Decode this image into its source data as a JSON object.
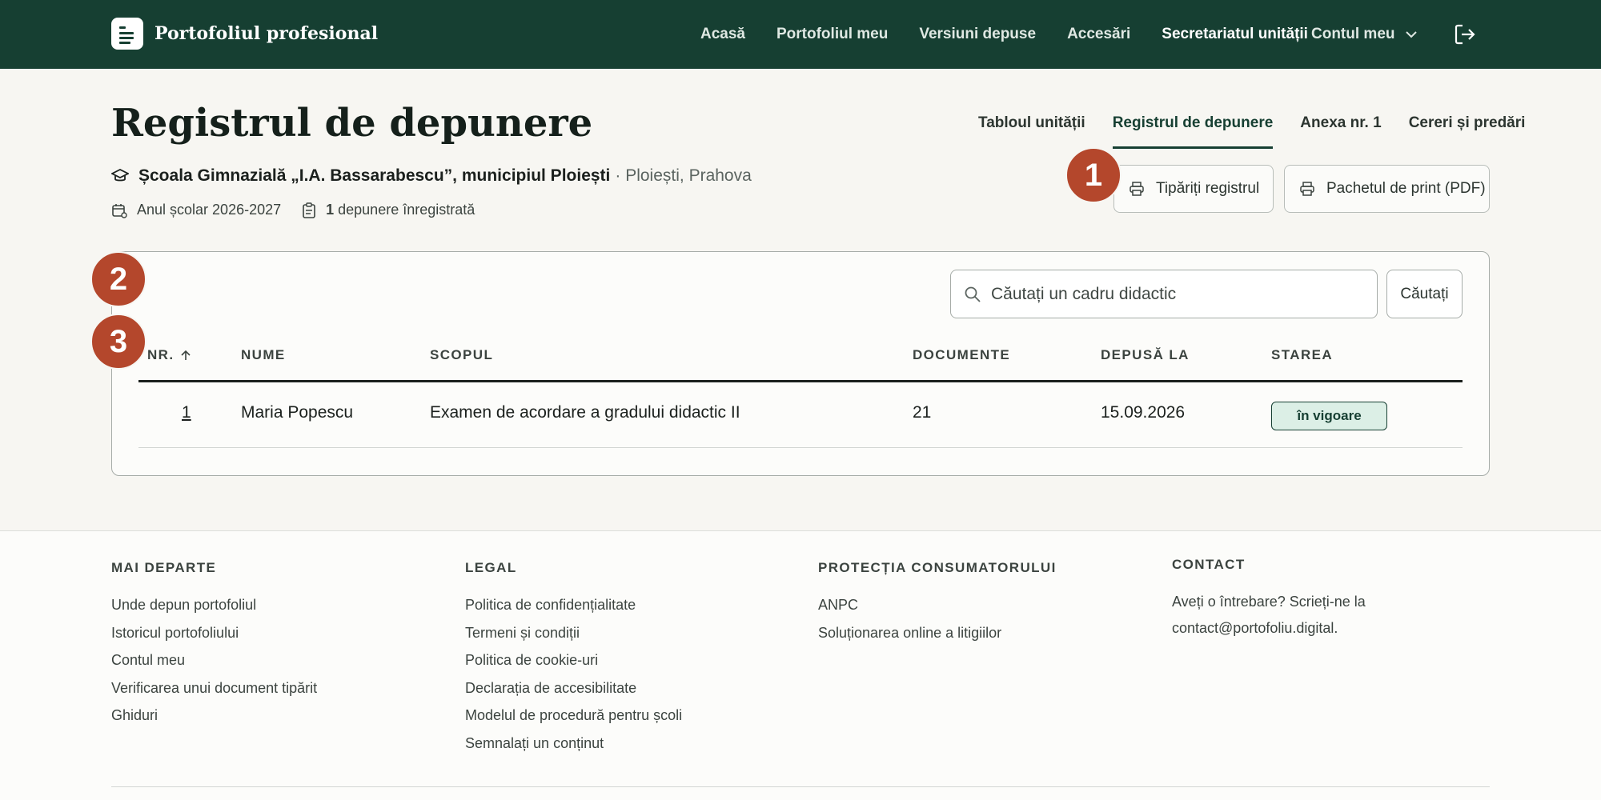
{
  "header": {
    "brand": "Portofoliul profesional",
    "nav": [
      {
        "label": "Acasă",
        "strong": false
      },
      {
        "label": "Portofoliul meu",
        "strong": false
      },
      {
        "label": "Versiuni depuse",
        "strong": false
      },
      {
        "label": "Accesări",
        "strong": false
      },
      {
        "label": "Secretariatul unității",
        "strong": true
      }
    ],
    "account": "Contul meu"
  },
  "page": {
    "title": "Registrul de depunere",
    "tabs": [
      "Tabloul unității",
      "Registrul de depunere",
      "Anexa nr. 1",
      "Cereri și predări"
    ],
    "school_name": "Școala Gimnazială „I.A. Bassarabescu”, municipiul Ploiești",
    "school_location": "· Ploiești, Prahova",
    "year": "Anul școlar 2026-2027",
    "count_num": "1",
    "count_text": " depunere înregistrată",
    "print_register": "Tipăriți registrul",
    "print_pack": "Pachetul de print (PDF)"
  },
  "markers": [
    "1",
    "2",
    "3"
  ],
  "search": {
    "placeholder": "Căutați un cadru didactic",
    "button": "Căutați"
  },
  "table": {
    "headers": [
      "NR.",
      "NUME",
      "SCOPUL",
      "DOCUMENTE",
      "DEPUSĂ LA",
      "STAREA"
    ],
    "rows": [
      {
        "nr": "1",
        "name": "Maria Popescu",
        "purpose": "Examen de acordare a gradului didactic II",
        "docs": "21",
        "date": "15.09.2026",
        "status": "în vigoare"
      }
    ]
  },
  "footer": {
    "col1": {
      "title": "MAI DEPARTE",
      "links": [
        "Unde depun portofoliul",
        "Istoricul portofoliului",
        "Contul meu",
        "Verificarea unui document tipărit",
        "Ghiduri"
      ]
    },
    "col2": {
      "title": "LEGAL",
      "links": [
        "Politica de confidențialitate",
        "Termeni și condiții",
        "Politica de cookie-uri",
        "Declarația de accesibilitate",
        "Modelul de procedură pentru școli",
        "Semnalați un conținut"
      ]
    },
    "col3": {
      "title": "PROTECȚIA CONSUMATORULUI",
      "links": [
        "ANPC",
        "Soluționarea online a litigiilor"
      ]
    },
    "col4": {
      "title": "CONTACT",
      "text": "Aveți o întrebare? Scrieți-ne la contact@portofoliu.digital."
    }
  },
  "colors": {
    "primary": "#163f32",
    "marker": "#b4472c",
    "status_bg": "#dcefe6"
  }
}
